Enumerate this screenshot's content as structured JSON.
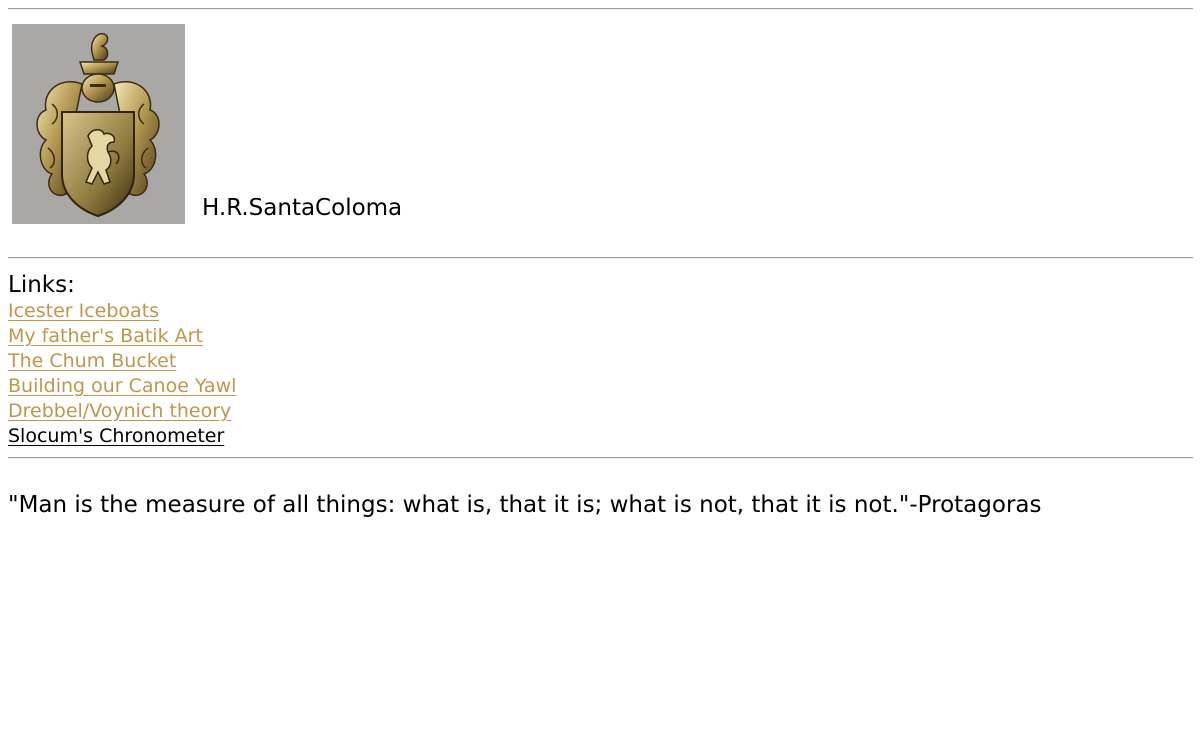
{
  "header": {
    "crest_image": "coat-of-arms-crest",
    "site_name": "H.R.SantaColoma"
  },
  "links_section": {
    "heading": "Links:",
    "items": [
      {
        "label": "Icester Iceboats"
      },
      {
        "label": "My father's Batik Art"
      },
      {
        "label": "The Chum Bucket"
      },
      {
        "label": "Building our Canoe Yawl"
      },
      {
        "label": "Drebbel/Voynich theory"
      },
      {
        "label": "Slocum's Chronometer"
      }
    ]
  },
  "quote": {
    "text": "\"Man is the measure of all things: what is, that it is; what is not, that it is not.\"-Protagoras"
  },
  "colors": {
    "link": "#c0954c",
    "link_visited": "#000000",
    "text": "#000000",
    "background": "#ffffff"
  }
}
